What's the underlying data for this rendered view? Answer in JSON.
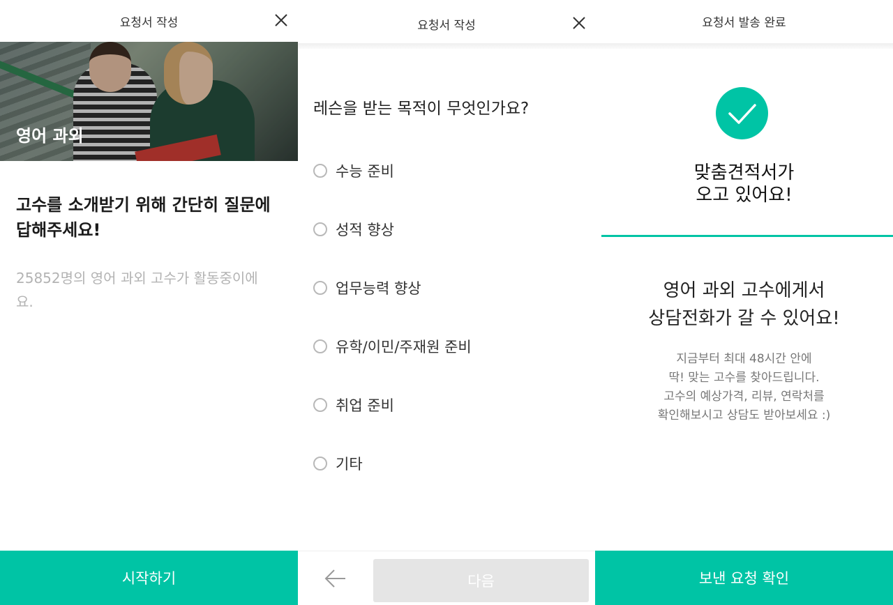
{
  "screen1": {
    "header_title": "요청서 작성",
    "hero_label": "영어 과외",
    "intro_title_line1": "고수를 소개받기 위해 간단히 질문에",
    "intro_title_line2": "답해주세요!",
    "intro_sub_line1": "25852명의 영어 과외 고수가 활동중이에",
    "intro_sub_line2": "요.",
    "start_button": "시작하기"
  },
  "screen2": {
    "header_title": "요청서 작성",
    "question": "레슨을 받는 목적이 무엇인가요?",
    "options": [
      {
        "label": "수능 준비"
      },
      {
        "label": "성적 향상"
      },
      {
        "label": "업무능력 향상"
      },
      {
        "label": "유학/이민/주재원 준비"
      },
      {
        "label": "취업 준비"
      },
      {
        "label": "기타"
      }
    ],
    "next_button": "다음"
  },
  "screen3": {
    "header_title": "요청서 발송 완료",
    "done_line1": "맞춤견적서가",
    "done_line2": "오고 있어요!",
    "call_line1": "영어 과외 고수에게서",
    "call_line2": "상담전화가 갈 수 있어요!",
    "desc_line1": "지금부터 최대 48시간 안에",
    "desc_line2": "딱! 맞는 고수를 찾아드립니다.",
    "desc_line3": "고수의 예상가격, 리뷰, 연락처를",
    "desc_line4": "확인해보시고 상담도 받아보세요 :)",
    "confirm_button": "보낸 요청 확인"
  },
  "colors": {
    "accent": "#00c4a5",
    "disabled_button": "#e5e5e5",
    "muted_text": "#b3b3b3"
  },
  "icons": [
    "close-icon",
    "back-arrow-icon",
    "check-icon",
    "radio-icon"
  ]
}
